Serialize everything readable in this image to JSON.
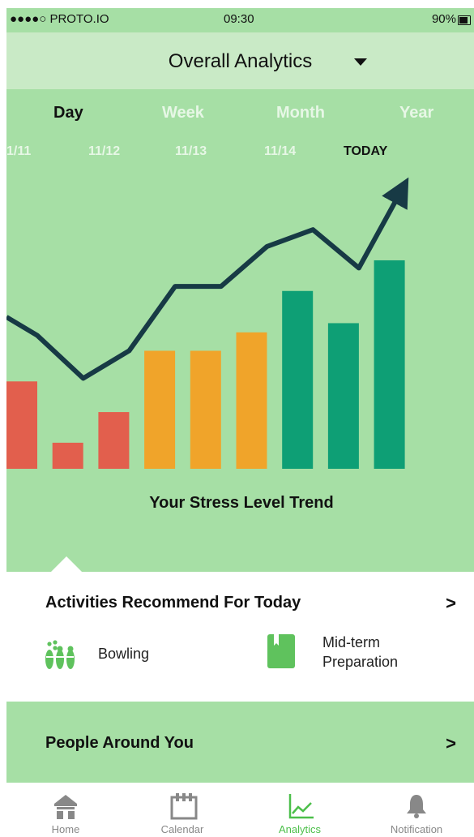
{
  "status_bar": {
    "carrier": "●●●●○ PROTO.IO",
    "time": "09:30",
    "battery": "90%"
  },
  "header": {
    "title": "Overall Analytics",
    "dropdown_icon": "caret-down-icon"
  },
  "period_tabs": [
    "Day",
    "Week",
    "Month",
    "Year"
  ],
  "selected_period": "Day",
  "date_labels": [
    "1/11",
    "11/12",
    "11/13",
    "11/14",
    "TODAY"
  ],
  "chart_data": {
    "type": "bar",
    "title": "Your Stress Level Trend",
    "values": [
      5.7,
      1.7,
      3.7,
      7.7,
      7.7,
      8.9,
      11.6,
      9.5,
      13.6
    ],
    "bar_colors": [
      "#e25f4d",
      "#e25f4d",
      "#e25f4d",
      "#f0a42a",
      "#f0a42a",
      "#f0a42a",
      "#0e9f75",
      "#0e9f75",
      "#0e9f75"
    ],
    "trend_line": [
      8.7,
      5.9,
      7.7,
      11.9,
      11.9,
      14.5,
      15.6,
      13.1,
      18.6
    ],
    "trend_color": "#173a45",
    "ylim": [
      0,
      20
    ]
  },
  "activities": {
    "title": "Activities Recommend For Today",
    "chevron_icon": "chevron-right-icon",
    "items": [
      {
        "icon": "bowling-icon",
        "label": "Bowling"
      },
      {
        "icon": "book-icon",
        "label": "Mid-term\nPreparation"
      }
    ]
  },
  "people": {
    "title": "People Around You",
    "chevron_icon": "chevron-right-icon"
  },
  "tab_bar": [
    {
      "icon": "home-icon",
      "label": "Home",
      "active": false
    },
    {
      "icon": "calendar-icon",
      "label": "Calendar",
      "active": false
    },
    {
      "icon": "analytics-icon",
      "label": "Analytics",
      "active": true
    },
    {
      "icon": "bell-icon",
      "label": "Notification",
      "active": false
    }
  ],
  "colors": {
    "accent_green": "#a6dfa5",
    "header_green": "#c9eac6",
    "active_tab": "#4cbf4a",
    "icon_green": "#5fc25d"
  }
}
